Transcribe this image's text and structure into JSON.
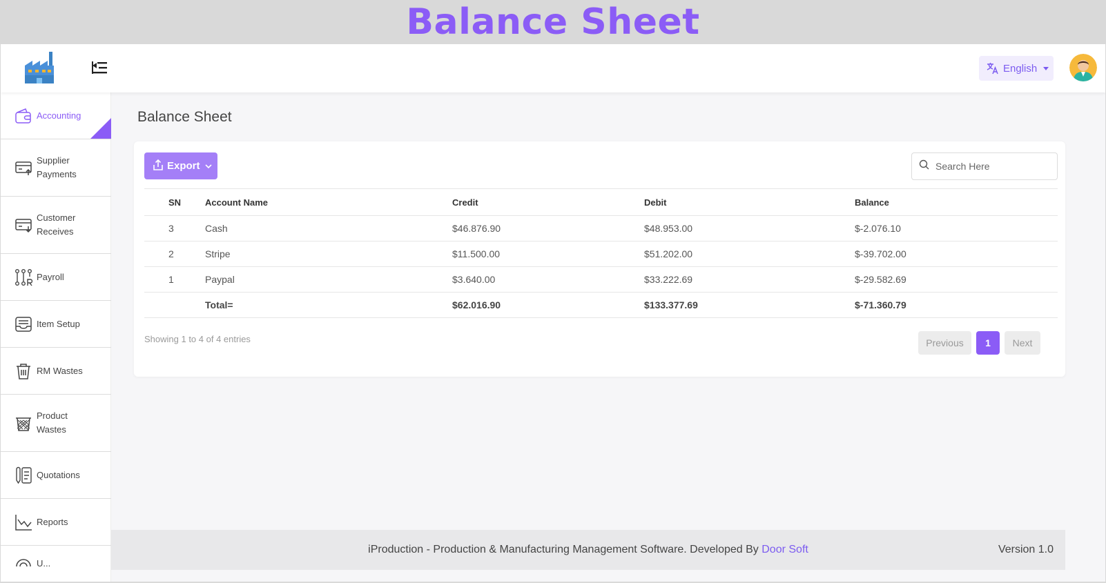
{
  "banner": {
    "title": "Balance Sheet"
  },
  "header": {
    "language": "English"
  },
  "sidebar": {
    "items": [
      {
        "label": "Accounting",
        "icon": "wallet-icon",
        "active": true
      },
      {
        "label": "Supplier\nPayments",
        "icon": "card-upload-icon"
      },
      {
        "label": "Customer\nReceives",
        "icon": "card-download-icon"
      },
      {
        "label": "Payroll",
        "icon": "payroll-icon"
      },
      {
        "label": "Item Setup",
        "icon": "tray-icon"
      },
      {
        "label": "RM Wastes",
        "icon": "trash-icon"
      },
      {
        "label": "Product\nWastes",
        "icon": "basket-icon"
      },
      {
        "label": "Quotations",
        "icon": "document-icon"
      },
      {
        "label": "Reports",
        "icon": "chart-line-icon"
      },
      {
        "label": "U...",
        "icon": "user-icon"
      }
    ]
  },
  "main": {
    "page_title": "Balance Sheet",
    "export_label": "Export",
    "search_placeholder": "Search Here",
    "table": {
      "headers": {
        "sn": "SN",
        "name": "Account Name",
        "credit": "Credit",
        "debit": "Debit",
        "balance": "Balance"
      },
      "rows": [
        {
          "sn": "3",
          "name": "Cash",
          "credit": "$46.876.90",
          "debit": "$48.953.00",
          "balance": "$-2.076.10"
        },
        {
          "sn": "2",
          "name": "Stripe",
          "credit": "$11.500.00",
          "debit": "$51.202.00",
          "balance": "$-39.702.00"
        },
        {
          "sn": "1",
          "name": "Paypal",
          "credit": "$3.640.00",
          "debit": "$33.222.69",
          "balance": "$-29.582.69"
        }
      ],
      "total": {
        "label": "Total=",
        "credit": "$62.016.90",
        "debit": "$133.377.69",
        "balance": "$-71.360.79"
      }
    },
    "showing": "Showing 1 to 4 of 4 entries",
    "pagination": {
      "previous": "Previous",
      "current": "1",
      "next": "Next"
    }
  },
  "footer": {
    "text": "iProduction - Production & Manufacturing Management Software. Developed By ",
    "brand": "Door Soft",
    "version": "Version 1.0"
  },
  "colors": {
    "accent": "#8b5cf6",
    "accent_light": "#a47ff7",
    "accent_bg": "#f1edfd"
  }
}
